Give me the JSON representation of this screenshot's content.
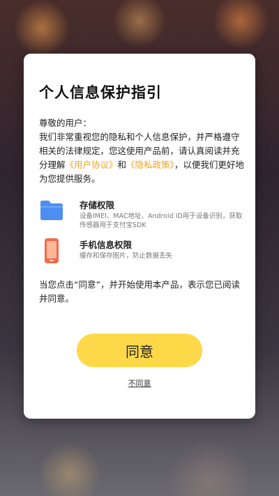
{
  "dialog": {
    "title": "个人信息保护指引",
    "greeting": "尊敬的用户：",
    "intro_text": "我们非常重视您的隐私和个人信息保护，并严格遵守相关的法律规定，您这使用产品前，请认真阅读并充分理解",
    "user_agreement_link": "《用户协议》",
    "and_text": "和",
    "privacy_policy_link": "《隐私政策》",
    "intro_suffix": "，以便我们更好地为您提供服务。",
    "permissions": [
      {
        "icon": "folder-icon",
        "title": "存储权限",
        "desc": "设备IMEI、MAC地址、Android ID用于设备识别，获取传感器用于支付宝SDK"
      },
      {
        "icon": "phone-icon",
        "title": "手机信息权限",
        "desc": "缓存和保存图片，防止数据丢失"
      }
    ],
    "consent_text": "当您点击“同意”，并开始使用本产品，表示您已阅读并同意。",
    "agree_label": "同意",
    "disagree_label": "不同意"
  },
  "colors": {
    "accent": "#fdd94a",
    "link": "#f0a51a",
    "folder": "#4d8ef2",
    "phone": "#f06b4a"
  }
}
